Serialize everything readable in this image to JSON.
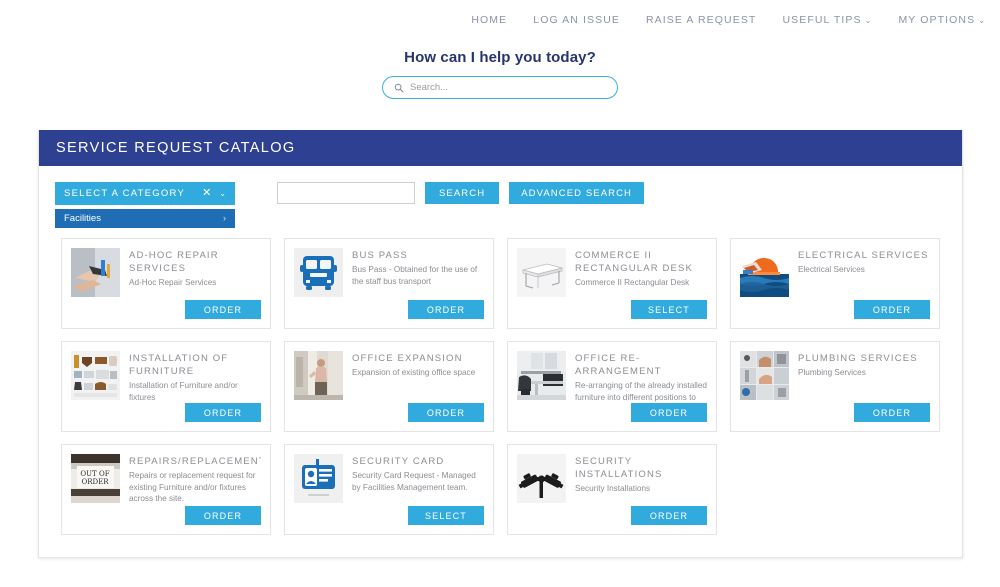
{
  "topnav": {
    "items": [
      {
        "label": "HOME",
        "caret": false
      },
      {
        "label": "LOG AN ISSUE",
        "caret": false
      },
      {
        "label": "RAISE A REQUEST",
        "caret": false
      },
      {
        "label": "USEFUL TIPS",
        "caret": true,
        "caret_glyph": "⌄"
      },
      {
        "label": "MY OPTIONS",
        "caret": true,
        "caret_glyph": "⌄"
      }
    ]
  },
  "hero": {
    "title": "How can I help you today?",
    "search_placeholder": "Search...",
    "search_value": "",
    "search_icon": "search-icon"
  },
  "panel": {
    "title": "SERVICE REQUEST CATALOG",
    "header_color": "#2e4091"
  },
  "toolbar": {
    "category_label": "SELECT A CATEGORY",
    "clear_glyph": "✕",
    "chevron_down_glyph": "⌄",
    "category_item": "Facilities",
    "category_item_chevron": "›",
    "keyword_value": "",
    "keyword_placeholder": "",
    "search_label": "SEARCH",
    "advanced_search_label": "ADVANCED SEARCH",
    "button_color": "#31aadd"
  },
  "catalog": {
    "items": [
      {
        "title": "AD-HOC REPAIR SERVICES",
        "desc": "Ad-Hoc Repair Services",
        "button": "ORDER",
        "thumb": "photo-hand-tool-repair"
      },
      {
        "title": "BUS PASS",
        "desc": "Bus Pass - Obtained for the use of the staff bus transport",
        "button": "ORDER",
        "thumb": "bus-icon"
      },
      {
        "title": "COMMERCE II RECTANGULAR DESK",
        "desc": "Commerce II Rectangular Desk",
        "button": "SELECT",
        "thumb": "desk-line-drawing"
      },
      {
        "title": "ELECTRICAL SERVICES",
        "desc": "Electrical Services",
        "button": "ORDER",
        "thumb": "hardhat-electrical"
      },
      {
        "title": "INSTALLATION OF FURNITURE",
        "desc": "Installation of Furniture and/or fixtures",
        "button": "ORDER",
        "thumb": "furniture-collage"
      },
      {
        "title": "OFFICE EXPANSION",
        "desc": "Expansion of existing office space",
        "button": "ORDER",
        "thumb": "photo-man-doorway"
      },
      {
        "title": "OFFICE RE-ARRANGEMENT",
        "desc": "Re-arranging of the already installed furniture into different positions to maximise office space",
        "button": "ORDER",
        "thumb": "photo-office-desks"
      },
      {
        "title": "PLUMBING SERVICES",
        "desc": "Plumbing Services",
        "button": "ORDER",
        "thumb": "plumbing-collage"
      },
      {
        "title": "REPAIRS/REPLACEMENT",
        "desc": "Repairs or replacement request for existing Furniture and/or fixtures across the site.",
        "button": "ORDER",
        "thumb": "out-of-order-sign"
      },
      {
        "title": "SECURITY CARD",
        "desc": "Security Card Request - Managed by Facilities Management team.",
        "button": "SELECT",
        "thumb": "id-badge-icon"
      },
      {
        "title": "SECURITY INSTALLATIONS",
        "desc": "Security Installations",
        "button": "ORDER",
        "thumb": "cctv-cameras-icon"
      }
    ]
  }
}
